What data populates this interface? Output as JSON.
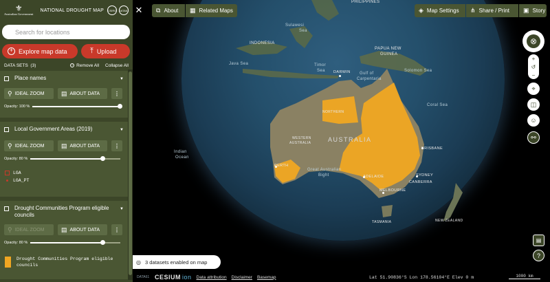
{
  "header": {
    "gov_text": "Australian Government",
    "app_title": "NATIONAL DROUGHT MAP",
    "partner_badge_1": "CSIRO",
    "partner_badge_2": "DATA61"
  },
  "search": {
    "placeholder": "Search for locations"
  },
  "actions": {
    "explore_label": "Explore map data",
    "upload_label": "Upload"
  },
  "datasets_bar": {
    "label": "DATA SETS",
    "count": "(3)",
    "remove_all": "Remove All",
    "collapse_all": "Collapse All"
  },
  "workbench": [
    {
      "title": "Place names",
      "zoom_label": "IDEAL ZOOM",
      "about_label": "ABOUT DATA",
      "opacity_label": "Opacity: 100 %",
      "opacity": 1.0
    },
    {
      "title": "Local Government Areas (2019)",
      "zoom_label": "IDEAL ZOOM",
      "about_label": "ABOUT DATA",
      "opacity_label": "Opacity: 80 %",
      "opacity": 0.8,
      "legend": [
        {
          "label": "LGA"
        },
        {
          "label": "LGA_PT"
        }
      ]
    },
    {
      "title": "Drought Communities Program eligible councils",
      "zoom_label": "IDEAL ZOOM",
      "zoom_disabled": true,
      "about_label": "ABOUT DATA",
      "opacity_label": "Opacity: 80 %",
      "opacity": 0.8,
      "legend": [
        {
          "label": "Drought Communities Program eligible councils",
          "color": "#f0a622"
        }
      ]
    }
  ],
  "toolbar": {
    "about": "About",
    "related_maps": "Related Maps",
    "map_settings": "Map Settings",
    "share_print": "Share / Print",
    "story": "Story"
  },
  "map_labels": {
    "australia": "AUSTRALIA",
    "darwin": "DARWIN",
    "perth": "PERTH",
    "adelaide": "ADELAIDE",
    "melbourne": "MELBOURNE",
    "sydney": "SYDNEY",
    "canberra": "CANBERRA",
    "brisbane": "BRISBANE",
    "papua": "PAPUA NEW",
    "guinea": "GUINEA",
    "sulawesi": "Sulawesi",
    "sea": "Sea",
    "indonesia": "INDONESIA",
    "timor": "Timor",
    "timor_sea": "Sea",
    "java_sea": "Java Sea",
    "gulf": "Gulf of",
    "carpentaria": "Carpentaria",
    "coral": "Coral Sea",
    "great_aus": "Great Australian",
    "bight": "Bight",
    "tasmania": "TASMANIA",
    "philippines": "PHILIPPINES",
    "solomon": "Solomon Sea",
    "indian": "Indian",
    "ocean": "Ocean",
    "western": "WESTERN",
    "australia_w": "AUSTRALIA",
    "nt": "NORTHERN",
    "nz": "NEW ZEALAND"
  },
  "status": {
    "datasets_enabled": "3 datasets enabled on map"
  },
  "bottom": {
    "data61": "DATA61",
    "cesium": "CESIUM",
    "ion": "ion",
    "attribution": "Data attribution",
    "disclaimer": "Disclaimer",
    "basemap": "Basemap",
    "coords": "Lat  51.90836°S  Lon  178.56104°E  Elev  0 m",
    "scale": "1000 km"
  },
  "controls": {
    "compass_icon": "compass-icon",
    "zoom_in": "+",
    "zoom_reset": "↺",
    "zoom_out": "−"
  },
  "colors": {
    "sidebar_bg": "#3c4628",
    "panel_bg": "#4a5633",
    "accent_red": "#c9392a",
    "drought_orange": "#f0a622"
  }
}
